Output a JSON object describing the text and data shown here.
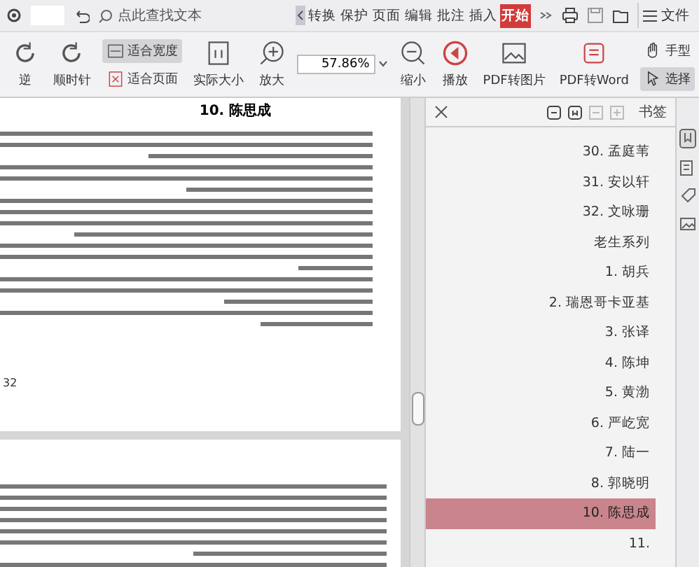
{
  "menu_bar": {
    "search": {
      "placeholder": "点此查找文本"
    },
    "tabs": [
      {
        "label": "转换",
        "selected": false
      },
      {
        "label": "保护",
        "selected": false
      },
      {
        "label": "页面",
        "selected": false
      },
      {
        "label": "编辑",
        "selected": false
      },
      {
        "label": "批注",
        "selected": false
      },
      {
        "label": "插入",
        "selected": false
      },
      {
        "label": "开始",
        "selected": true
      }
    ],
    "file_label": "文件"
  },
  "ribbon": {
    "tools": [
      {
        "kind": "big",
        "label": "逆"
      },
      {
        "kind": "big",
        "label": "顺时针"
      },
      {
        "kind": "pair",
        "items": [
          {
            "label": "适合宽度",
            "selected": true
          },
          {
            "label": "适合页面",
            "selected": false
          }
        ]
      },
      {
        "kind": "big",
        "label": "实际大小"
      },
      {
        "kind": "big",
        "label": "放大"
      },
      {
        "kind": "zoom",
        "value": "57.86%"
      },
      {
        "kind": "big",
        "label": "缩小"
      },
      {
        "kind": "big",
        "label": "播放"
      },
      {
        "kind": "big",
        "label": "PDF转图片"
      },
      {
        "kind": "big",
        "label": "PDF转Word"
      },
      {
        "kind": "pair",
        "items": [
          {
            "label": "手型",
            "selected": false
          },
          {
            "label": "选择",
            "selected": true
          }
        ]
      }
    ]
  },
  "document": {
    "heading": "10. 陈思成",
    "page_number": "32"
  },
  "bookmarks": {
    "title": "书签",
    "items": [
      {
        "label": "30. 孟庭苇",
        "selected": false
      },
      {
        "label": "31. 安以轩",
        "selected": false
      },
      {
        "label": "32. 文咏珊",
        "selected": false
      },
      {
        "label": "老生系列",
        "selected": false
      },
      {
        "label": "1. 胡兵",
        "selected": false
      },
      {
        "label": "2. 瑞恩哥卡亚基",
        "selected": false
      },
      {
        "label": "3. 张译",
        "selected": false
      },
      {
        "label": "4. 陈坤",
        "selected": false
      },
      {
        "label": "5. 黄渤",
        "selected": false
      },
      {
        "label": "6. 严屹宽",
        "selected": false
      },
      {
        "label": "7. 陆一",
        "selected": false
      },
      {
        "label": "8. 郭晓明",
        "selected": false
      },
      {
        "label": "10. 陈思成",
        "selected": true
      },
      {
        "label": "11.",
        "selected": false
      }
    ]
  }
}
